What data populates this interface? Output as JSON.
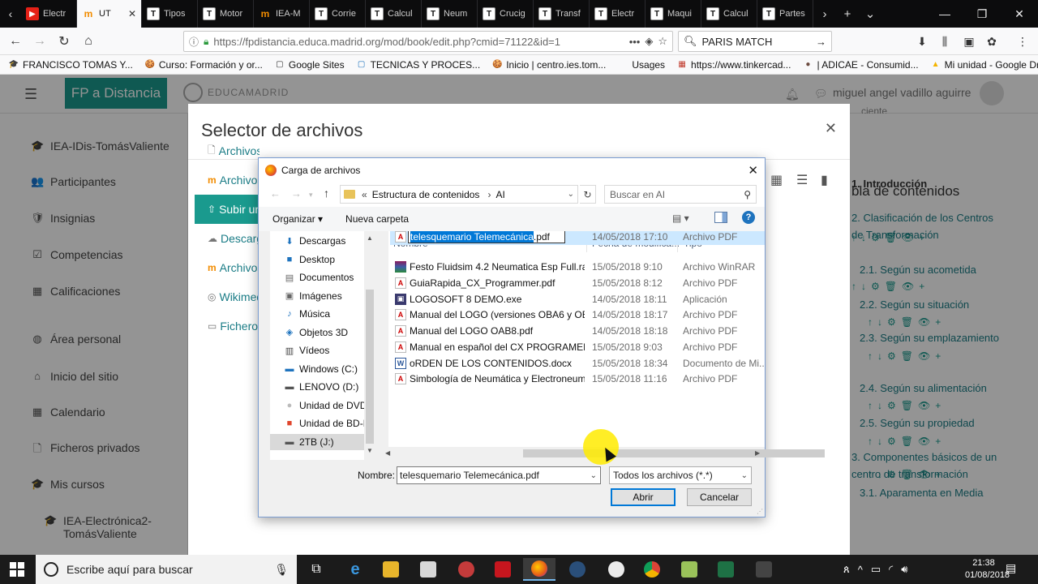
{
  "browser": {
    "tabs": [
      {
        "label": "Electr",
        "icon": "yt"
      },
      {
        "label": "UT",
        "icon": "mo",
        "active": true
      },
      {
        "label": "Tipos",
        "icon": "t"
      },
      {
        "label": "Motor",
        "icon": "t"
      },
      {
        "label": "IEA-M",
        "icon": "mo"
      },
      {
        "label": "Corrie",
        "icon": "t"
      },
      {
        "label": "Calcul",
        "icon": "t"
      },
      {
        "label": "Neum",
        "icon": "t"
      },
      {
        "label": "Crucig",
        "icon": "t"
      },
      {
        "label": "Transf",
        "icon": "t"
      },
      {
        "label": "Electr",
        "icon": "t"
      },
      {
        "label": "Maqui",
        "icon": "t"
      },
      {
        "label": "Calcul",
        "icon": "t"
      },
      {
        "label": "Partes",
        "icon": "t"
      }
    ],
    "url": "https://fpdistancia.educa.madrid.org/mod/book/edit.php?cmid=71122&id=1",
    "search_value": "PARIS MATCH",
    "bookmarks": [
      {
        "label": "FRANCISCO TOMAS Y..."
      },
      {
        "label": "Curso: Formación y or..."
      },
      {
        "label": "Google Sites"
      },
      {
        "label": "TECNICAS Y PROCES..."
      },
      {
        "label": "Inicio | centro.ies.tom..."
      },
      {
        "label": "Usages"
      },
      {
        "label": "https://www.tinkercad..."
      },
      {
        "label": "| ADICAE - Consumid..."
      },
      {
        "label": "Mi unidad - Google Dr..."
      }
    ]
  },
  "moodle": {
    "brand": "FP a Distancia",
    "logo_text": "EDUCAMADRID",
    "user_name": "miguel angel vadillo aguirre",
    "user_sub": "ciente",
    "sidebar": [
      {
        "label": "IEA-IDis-TomásValiente",
        "icon": "🎓"
      },
      {
        "label": "Participantes",
        "icon": "👥"
      },
      {
        "label": "Insignias",
        "icon": "🛡"
      },
      {
        "label": "Competencias",
        "icon": "☑"
      },
      {
        "label": "Calificaciones",
        "icon": "▦"
      },
      {
        "label": "Área personal",
        "icon": "◍"
      },
      {
        "label": "Inicio del sitio",
        "icon": "⌂"
      },
      {
        "label": "Calendario",
        "icon": "▦"
      },
      {
        "label": "Ficheros privados",
        "icon": "🗋"
      },
      {
        "label": "Mis cursos",
        "icon": "🎓"
      },
      {
        "label": "IEA-Electrónica2-TomásValiente",
        "icon": "🎓"
      }
    ],
    "toc": {
      "title": "bla de contenidos",
      "entries": [
        {
          "label": "1. Introducción",
          "bold": true
        },
        {
          "label": "2. Clasificación de los Centros de Transformación"
        },
        {
          "label": "2.1. Según su acometida"
        },
        {
          "label": "2.2. Según su situación"
        },
        {
          "label": "2.3. Según su emplazamiento"
        },
        {
          "label": "2.4. Según su alimentación"
        },
        {
          "label": "2.5. Según su propiedad"
        },
        {
          "label": "3. Componentes básicos de un centro de transformación"
        },
        {
          "label": "3.1. Aparamenta en Media"
        }
      ]
    }
  },
  "file_picker": {
    "title": "Selector de archivos",
    "repositories": [
      {
        "label": "Archivos recientes",
        "icon": "🗋"
      },
      {
        "label": "Archivos privados",
        "icon": "m"
      },
      {
        "label": "Subir un archivo",
        "icon": "⇧",
        "active": true
      },
      {
        "label": "Descargador URL",
        "icon": "☁"
      },
      {
        "label": "Archivos del curso",
        "icon": "m"
      },
      {
        "label": "Wikimedia",
        "icon": "◎"
      },
      {
        "label": "Ficheros incrustados",
        "icon": "▭"
      }
    ]
  },
  "dialog": {
    "title": "Carga de archivos",
    "breadcrumb": [
      "Estructura de contenidos",
      "AI"
    ],
    "breadcrumb_prefix": "«",
    "search_placeholder": "Buscar en AI",
    "organize_label": "Organizar ▾",
    "new_folder_label": "Nueva carpeta",
    "nav_items": [
      {
        "label": "Descargas",
        "icon": "⬇",
        "color": "#1e73be"
      },
      {
        "label": "Desktop",
        "icon": "■",
        "color": "#1e73be"
      },
      {
        "label": "Documentos",
        "icon": "▤",
        "color": "#666"
      },
      {
        "label": "Imágenes",
        "icon": "▣",
        "color": "#666"
      },
      {
        "label": "Música",
        "icon": "♪",
        "color": "#1e73be"
      },
      {
        "label": "Objetos 3D",
        "icon": "◈",
        "color": "#1e73be"
      },
      {
        "label": "Vídeos",
        "icon": "▥",
        "color": "#444"
      },
      {
        "label": "Windows (C:)",
        "icon": "▬",
        "color": "#1e73be"
      },
      {
        "label": "LENOVO (D:)",
        "icon": "▬",
        "color": "#555"
      },
      {
        "label": "Unidad de DVD R",
        "icon": "●",
        "color": "#bbb"
      },
      {
        "label": "Unidad de BD-R",
        "icon": "■",
        "color": "#e0452c"
      },
      {
        "label": "2TB (J:)",
        "icon": "▬",
        "color": "#555",
        "selected": true
      }
    ],
    "columns": {
      "name": "Nombre",
      "date": "Fecha de modifica...",
      "type": "Tipo"
    },
    "files": [
      {
        "name": "Festo Fluidsim 4.2 Neumatica Esp Full.rar",
        "date": "15/05/2018 9:10",
        "type": "Archivo WinRAR",
        "kind": "rar"
      },
      {
        "name": "GuiaRapida_CX_Programmer.pdf",
        "date": "15/05/2018 8:12",
        "type": "Archivo PDF",
        "kind": "pdf"
      },
      {
        "name": "LOGOSOFT 8 DEMO.exe",
        "date": "14/05/2018 18:11",
        "type": "Aplicación",
        "kind": "exe"
      },
      {
        "name": "Manual del LOGO (versiones OBA6 y OB...",
        "date": "14/05/2018 18:17",
        "type": "Archivo PDF",
        "kind": "pdf"
      },
      {
        "name": "Manual del LOGO OAB8.pdf",
        "date": "14/05/2018 18:18",
        "type": "Archivo PDF",
        "kind": "pdf"
      },
      {
        "name": "Manual en español del CX PROGRAMER.",
        "date": "15/05/2018 9:03",
        "type": "Archivo PDF",
        "kind": "pdf"
      },
      {
        "name": "oRDEN DE LOS CONTENIDOS.docx",
        "date": "15/05/2018 18:34",
        "type": "Documento de Mi...",
        "kind": "doc"
      },
      {
        "name": "Simbología de Neumática y Electroneum...",
        "date": "15/05/2018 11:16",
        "type": "Archivo PDF",
        "kind": "pdf"
      }
    ],
    "selected_file": {
      "name_highlight": "telesquemario Telemecánica",
      "name_ext": ".pdf",
      "date": "14/05/2018 17:10",
      "type": "Archivo PDF"
    },
    "filename_label": "Nombre:",
    "filename_value": "telesquemario Telemecánica.pdf",
    "filetype_value": "Todos los archivos (*.*)",
    "open_label": "Abrir",
    "cancel_label": "Cancelar"
  },
  "taskbar": {
    "search_placeholder": "Escribe aquí para buscar",
    "time": "21:38",
    "date": "01/08/2018"
  }
}
